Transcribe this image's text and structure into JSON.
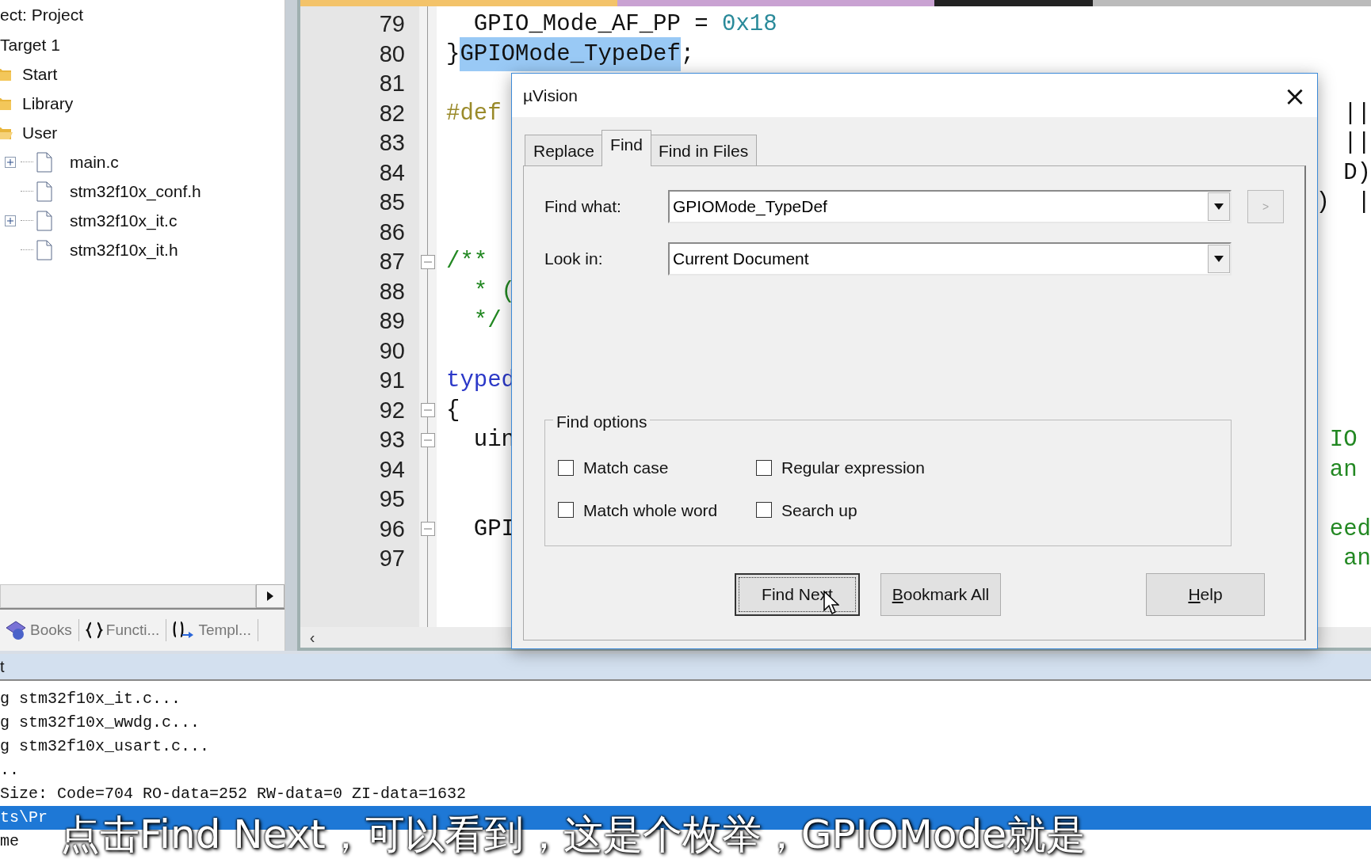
{
  "project_tree": {
    "header": "ect: Project",
    "target": "Target 1",
    "groups": [
      {
        "label": "Start",
        "expanded": false
      },
      {
        "label": "Library",
        "expanded": false
      },
      {
        "label": "User",
        "expanded": true,
        "children": [
          {
            "label": "main.c",
            "expandable": true
          },
          {
            "label": "stm32f10x_conf.h",
            "expandable": false
          },
          {
            "label": "stm32f10x_it.c",
            "expandable": true
          },
          {
            "label": "stm32f10x_it.h",
            "expandable": false
          }
        ]
      }
    ]
  },
  "panel_tabs": [
    {
      "label": "Books",
      "kind": "books"
    },
    {
      "label": "Functi...",
      "kind": "functions"
    },
    {
      "label": "Templ...",
      "kind": "templates"
    }
  ],
  "editor": {
    "scroll_left": "‹",
    "lines": [
      {
        "number": "79",
        "foldable": false,
        "code": "  GPIO_Mode_AF_PP = ",
        "code_value": "0x18"
      },
      {
        "number": "80",
        "foldable": false,
        "code": "}",
        "highlight": "GPIOMode_TypeDef",
        "code_after": ";"
      },
      {
        "number": "81",
        "foldable": false
      },
      {
        "number": "82",
        "foldable": false,
        "code": "#def",
        "kind": "preproc",
        "right": "||",
        "right_comment": false
      },
      {
        "number": "83",
        "foldable": false,
        "right": "||",
        "right_comment": false
      },
      {
        "number": "84",
        "foldable": false,
        "right": "D)",
        "right_comment": false
      },
      {
        "number": "85",
        "foldable": false,
        "right": ")  |",
        "right_comment": false
      },
      {
        "number": "86",
        "foldable": false
      },
      {
        "number": "87",
        "foldable": true,
        "code": "/**",
        "kind": "comment"
      },
      {
        "number": "88",
        "foldable": false,
        "code": "  * (",
        "kind": "comment"
      },
      {
        "number": "89",
        "foldable": false,
        "code": "  */",
        "kind": "comment"
      },
      {
        "number": "90",
        "foldable": false
      },
      {
        "number": "91",
        "foldable": false,
        "code": "typed",
        "kind": "keyword"
      },
      {
        "number": "92",
        "foldable": true,
        "code": "{"
      },
      {
        "number": "93",
        "foldable": true,
        "code": "  uin",
        "right": "IO ",
        "right_comment": true
      },
      {
        "number": "94",
        "foldable": false,
        "right": "an ",
        "right_comment": true
      },
      {
        "number": "95",
        "foldable": false
      },
      {
        "number": "96",
        "foldable": true,
        "code": "  GPI",
        "right": "eed",
        "right_comment": true
      },
      {
        "number": "97",
        "foldable": false,
        "right": "an",
        "right_comment": true
      }
    ]
  },
  "dialog": {
    "title": "µVision",
    "close": "×",
    "tabs": [
      {
        "label": "Replace",
        "selected": false
      },
      {
        "label": "Find",
        "selected": true
      },
      {
        "label": "Find in Files",
        "selected": false
      }
    ],
    "find_what": {
      "label": "Find what:",
      "value": "GPIOMode_TypeDef"
    },
    "history_button": {
      "label": ">",
      "disabled": true
    },
    "look_in": {
      "label": "Look in:",
      "value": "Current Document"
    },
    "options": {
      "title": "Find options",
      "checkboxes": [
        {
          "label": "Match case",
          "checked": false
        },
        {
          "label": "Regular expression",
          "checked": false
        },
        {
          "label": "Match whole word",
          "checked": false
        },
        {
          "label": "Search up",
          "checked": false
        }
      ]
    },
    "buttons": [
      {
        "label": "Find Next",
        "underline_first": false,
        "focused": true
      },
      {
        "label": "Bookmark All",
        "underline_first": true,
        "focused": false
      },
      {
        "label": "Help",
        "underline_first": true,
        "focused": false
      }
    ]
  },
  "output": {
    "header": "t",
    "lines": [
      {
        "text": "g stm32f10x_it.c...",
        "selected": false
      },
      {
        "text": "g stm32f10x_wwdg.c...",
        "selected": false
      },
      {
        "text": "g stm32f10x_usart.c...",
        "selected": false
      },
      {
        "text": "..",
        "selected": false
      },
      {
        "text": "Size: Code=704 RO-data=252 RW-data=0 ZI-data=1632",
        "selected": false
      },
      {
        "text": "ts\\Pr",
        "selected": true
      },
      {
        "text": "me",
        "selected": false
      }
    ]
  },
  "subtitle": "点击Find Next，可以看到，这是个枚举，GPIOMode就是"
}
